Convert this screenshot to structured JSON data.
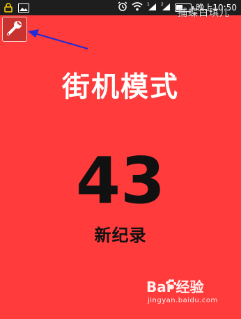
{
  "status_bar": {
    "time": "晚上10:50",
    "battery_fill_fraction": 0.45,
    "icons": [
      "lock-notification-icon",
      "image-notification-icon",
      "alarm-icon",
      "wifi-icon",
      "sim1-signal-icon",
      "sim2-signal-icon",
      "battery-icon"
    ]
  },
  "watermark_top": "捕蝶白琪儿",
  "toolbar": {
    "settings_icon": "wrench-icon"
  },
  "annotation": {
    "arrow_color": "#1f2bd6"
  },
  "game": {
    "mode_title": "街机模式",
    "score": "43",
    "score_label": "新纪录"
  },
  "watermark": {
    "logo_text": "Bai 经验",
    "url": "jingyan.baidu.com"
  },
  "colors": {
    "background": "#ff3b3b",
    "status_bar": "#1e1e1e",
    "score": "#111111",
    "title": "#ffffff"
  }
}
